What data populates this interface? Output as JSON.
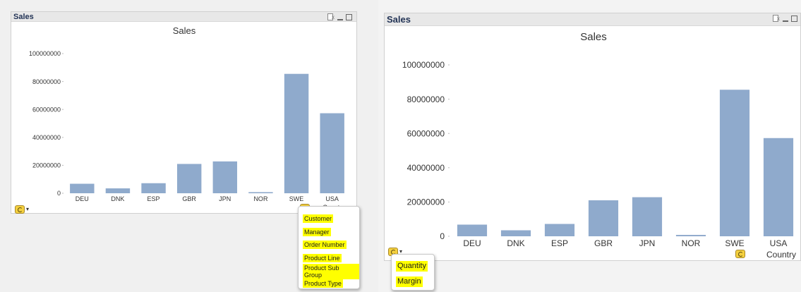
{
  "left": {
    "caption": "Sales",
    "menu": [
      "Customer",
      "Manager",
      "Order Number",
      "Product Line",
      "Product Sub Group",
      "Product Type"
    ]
  },
  "right": {
    "caption": "Sales",
    "menu": [
      "Quantity",
      "Margin"
    ]
  },
  "colors": {
    "bar": "#8faacc",
    "highlight": "#ffff00",
    "caption_bg": "#e8e8e8"
  },
  "chart_data": [
    {
      "type": "bar",
      "title": "Sales",
      "xlabel": "Country",
      "ylabel": "",
      "categories": [
        "DEU",
        "DNK",
        "ESP",
        "GBR",
        "JPN",
        "NOR",
        "SWE",
        "USA"
      ],
      "values": [
        6800000,
        3500000,
        7200000,
        21000000,
        22800000,
        800000,
        85500000,
        57300000
      ],
      "ylim": [
        0,
        100000000
      ],
      "yticks": [
        "0",
        "20000000",
        "40000000",
        "60000000",
        "80000000",
        "100000000"
      ],
      "grid": false,
      "legend": "none"
    },
    {
      "type": "bar",
      "title": "Sales",
      "xlabel": "Country",
      "ylabel": "",
      "categories": [
        "DEU",
        "DNK",
        "ESP",
        "GBR",
        "JPN",
        "NOR",
        "SWE",
        "USA"
      ],
      "values": [
        6800000,
        3500000,
        7200000,
        21000000,
        22800000,
        800000,
        85500000,
        57300000
      ],
      "ylim": [
        0,
        100000000
      ],
      "yticks": [
        "0",
        "20000000",
        "40000000",
        "60000000",
        "80000000",
        "100000000"
      ],
      "grid": false,
      "legend": "none"
    }
  ]
}
